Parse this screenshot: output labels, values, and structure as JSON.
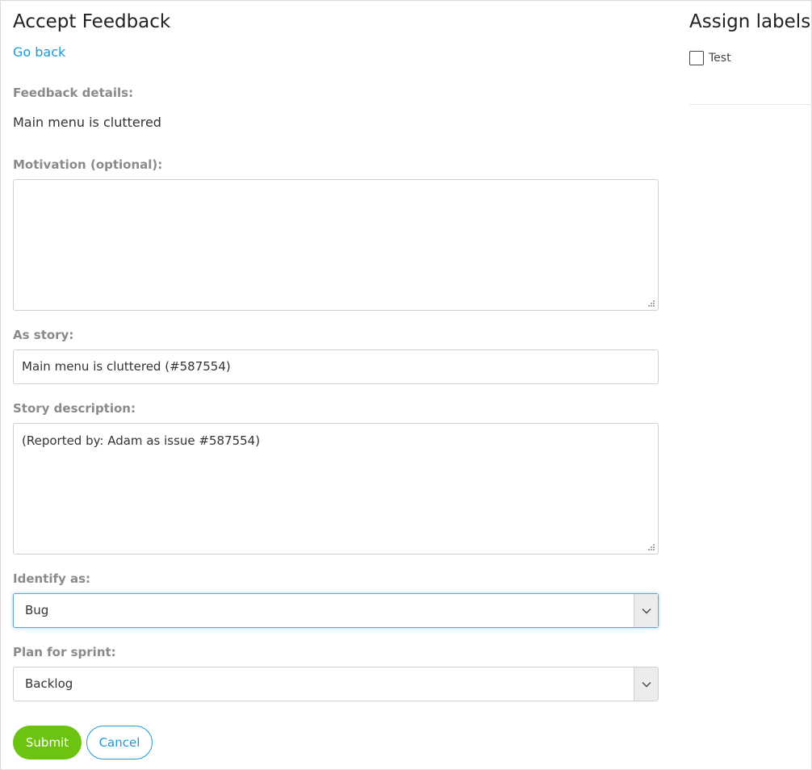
{
  "page": {
    "title": "Accept Feedback",
    "go_back": "Go back"
  },
  "feedback": {
    "details_label": "Feedback details:",
    "details_value": "Main menu is cluttered"
  },
  "motivation": {
    "label": "Motivation (optional):",
    "value": ""
  },
  "story": {
    "label": "As story:",
    "value": "Main menu is cluttered (#587554)"
  },
  "story_description": {
    "label": "Story description:",
    "value": "(Reported by: Adam as issue #587554)"
  },
  "identify_as": {
    "label": "Identify as:",
    "selected": "Bug"
  },
  "plan_for_sprint": {
    "label": "Plan for sprint:",
    "selected": "Backlog"
  },
  "actions": {
    "submit": "Submit",
    "cancel": "Cancel"
  },
  "labels_panel": {
    "title": "Assign labels",
    "items": [
      {
        "label": "Test",
        "checked": false
      }
    ]
  },
  "colors": {
    "link": "#1a9bd7",
    "submit_bg": "#6cc310",
    "label_gray": "#8a8a8a",
    "focus_ring": "#5aa7d4"
  },
  "icons": {
    "select_arrow": "chevron-down-icon",
    "resize": "resize-grip-icon"
  }
}
